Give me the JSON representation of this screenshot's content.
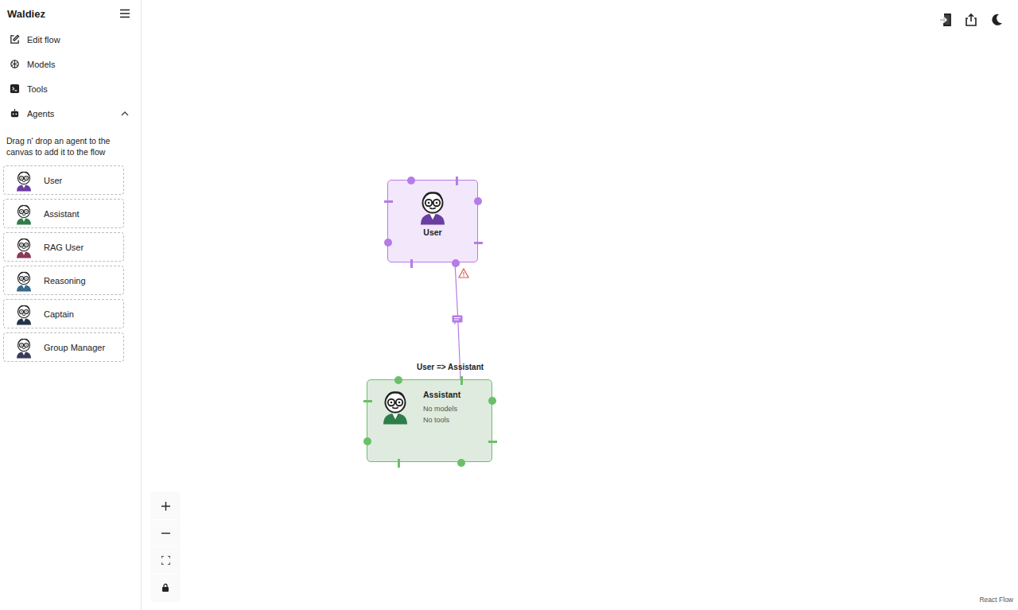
{
  "app": {
    "title": "Waldiez"
  },
  "sidebar": {
    "items": [
      {
        "label": "Edit flow",
        "icon": "edit"
      },
      {
        "label": "Models",
        "icon": "model"
      },
      {
        "label": "Tools",
        "icon": "terminal"
      },
      {
        "label": "Agents",
        "icon": "robot",
        "expanded": true
      }
    ],
    "hint": "Drag n' drop an agent to the canvas to add it to the flow",
    "agents": [
      {
        "label": "User",
        "color": "#6a3fa0"
      },
      {
        "label": "Assistant",
        "color": "#2f7d4a"
      },
      {
        "label": "RAG User",
        "color": "#8a3a5a"
      },
      {
        "label": "Reasoning",
        "color": "#3a6a8a"
      },
      {
        "label": "Captain",
        "color": "#24324a"
      },
      {
        "label": "Group Manager",
        "color": "#3a3a5a"
      }
    ]
  },
  "canvas": {
    "nodes": [
      {
        "name": "User",
        "kind": "user",
        "color": "#b57be6",
        "details": []
      },
      {
        "name": "Assistant",
        "kind": "assistant",
        "color": "#6abf69",
        "details": [
          "No models",
          "No tools"
        ]
      }
    ],
    "edges": [
      {
        "source": "User",
        "target": "Assistant",
        "label": "User => Assistant",
        "warning": true
      }
    ],
    "attribution": "React Flow"
  }
}
